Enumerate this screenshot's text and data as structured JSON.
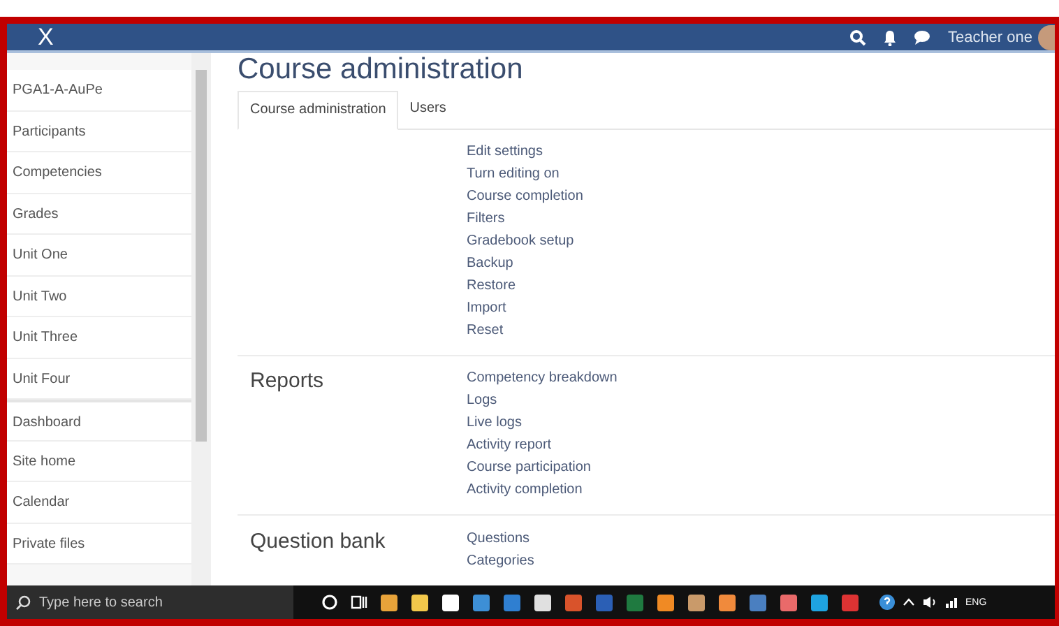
{
  "navbar": {
    "close": "X",
    "user_name": "Teacher one"
  },
  "sidebar": {
    "items": [
      {
        "label": "PGA1-A-AuPe"
      },
      {
        "label": "Participants"
      },
      {
        "label": "Competencies"
      },
      {
        "label": "Grades"
      },
      {
        "label": "Unit One"
      },
      {
        "label": "Unit Two"
      },
      {
        "label": "Unit Three"
      },
      {
        "label": "Unit Four"
      },
      {
        "label": "Dashboard"
      },
      {
        "label": "Site home"
      },
      {
        "label": "Calendar"
      },
      {
        "label": "Private files"
      }
    ]
  },
  "page": {
    "title": "Course administration",
    "tabs": [
      {
        "label": "Course administration",
        "selected": true
      },
      {
        "label": "Users",
        "selected": false
      }
    ],
    "sections": [
      {
        "links": [
          "Edit settings",
          "Turn editing on",
          "Course completion",
          "Filters",
          "Gradebook setup",
          "Backup",
          "Restore",
          "Import",
          "Reset"
        ]
      },
      {
        "heading": "Reports",
        "links": [
          "Competency breakdown",
          "Logs",
          "Live logs",
          "Activity report",
          "Course participation",
          "Activity completion"
        ]
      },
      {
        "heading": "Question bank",
        "links": [
          "Questions",
          "Categories"
        ]
      }
    ]
  },
  "taskbar": {
    "search_placeholder": "Type here to search",
    "tray_language": "ENG"
  }
}
